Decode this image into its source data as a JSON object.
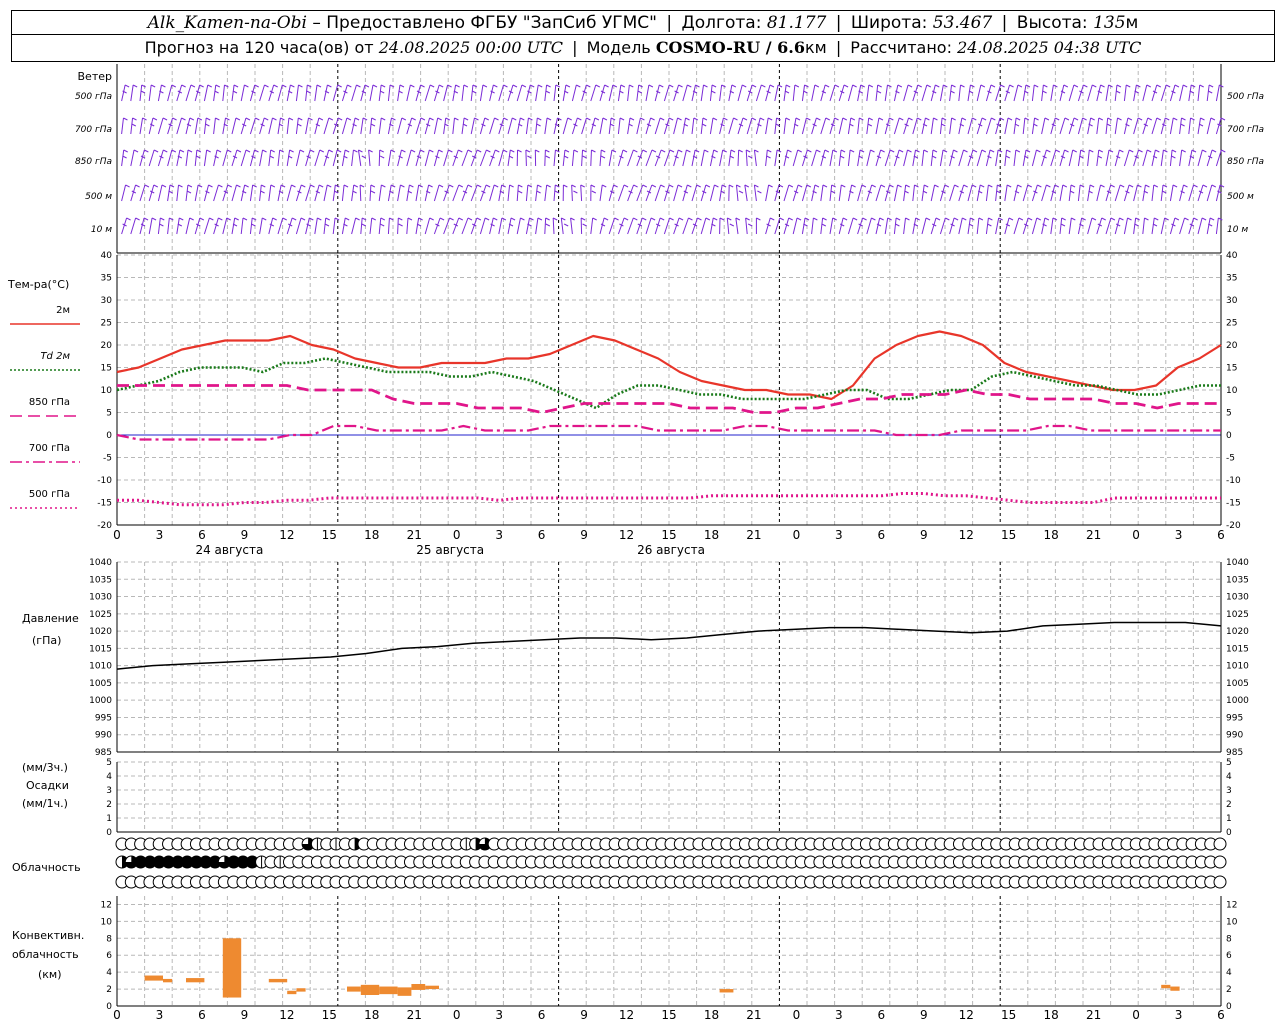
{
  "header": {
    "station": "Alk_Kamen-na-Obi",
    "provider": "– Предоставлено ФГБУ \"ЗапСиб УГМС\"",
    "lon_label": "Долгота:",
    "lon_value": "81.177",
    "lat_label": "Широта:",
    "lat_value": "53.467",
    "alt_label": "Высота:",
    "alt_value": "135",
    "alt_unit": "м",
    "forecast_label": "Прогноз на 120 часа(ов) от",
    "forecast_start": "24.08.2025 00:00 UTC",
    "model_label": "Модель",
    "model_name": "COSMO-RU / 6.6",
    "model_unit": "км",
    "calc_label": "Рассчитано:",
    "calc_time": "24.08.2025 04:38 UTC"
  },
  "colors": {
    "t2m": "#e8352a",
    "td2m": "#1a7a1a",
    "t850": "#e0158a",
    "t700": "#e0158a",
    "t500": "#e0158a",
    "wind": "#7a2bd6",
    "pressure": "#000000",
    "convective": "#ee8a30",
    "grid": "#b8b8b8"
  },
  "time_axis": {
    "hour_ticks": [
      "0",
      "3",
      "6",
      "9",
      "12",
      "15",
      "18",
      "21",
      "0",
      "3",
      "6",
      "9",
      "12",
      "15",
      "18",
      "21",
      "0",
      "3",
      "6",
      "9",
      "12",
      "15",
      "18",
      "21",
      "0",
      "3",
      "6"
    ],
    "day_labels": [
      "24 августа",
      "25 августа",
      "26 августа"
    ]
  },
  "chart_data": [
    {
      "panel": "wind",
      "type": "table",
      "title": "Ветер",
      "levels": [
        "500 гПа",
        "700 гПа",
        "850 гПа",
        "500 м",
        "10 м"
      ],
      "x_hours": [
        0,
        120
      ]
    },
    {
      "panel": "temperature",
      "type": "line",
      "title": "Тем-ра(°С)",
      "x_hours_step": 3,
      "ylim": [
        -20,
        40
      ],
      "y_ticks": [
        40,
        35,
        30,
        25,
        20,
        15,
        10,
        5,
        0,
        -5,
        -10,
        -15,
        -20
      ],
      "grid": true,
      "series": [
        {
          "name": "2м",
          "style": "solid",
          "values": [
            14,
            15,
            17,
            19,
            20,
            21,
            21,
            21,
            22,
            20,
            19,
            17,
            16,
            15,
            15,
            16,
            16,
            16,
            17,
            17,
            18,
            20,
            22,
            21,
            19,
            17,
            14,
            12,
            11,
            10,
            10,
            9,
            9,
            8,
            11,
            17,
            20,
            22,
            23,
            22,
            20,
            16,
            14,
            13,
            12,
            11,
            10,
            10,
            11,
            15,
            17,
            20
          ]
        },
        {
          "name": "Td 2м",
          "style": "dotted",
          "values": [
            10,
            11,
            12,
            14,
            15,
            15,
            15,
            14,
            16,
            16,
            17,
            16,
            15,
            14,
            14,
            14,
            13,
            13,
            14,
            13,
            12,
            10,
            8,
            6,
            9,
            11,
            11,
            10,
            9,
            9,
            8,
            8,
            8,
            8,
            9,
            10,
            10,
            8,
            8,
            9,
            10,
            10,
            13,
            14,
            13,
            12,
            11,
            11,
            10,
            9,
            9,
            10,
            11,
            11
          ]
        },
        {
          "name": "850 гПа",
          "style": "dashed",
          "values": [
            11,
            11,
            11,
            11,
            11,
            11,
            11,
            11,
            11,
            10,
            10,
            10,
            10,
            8,
            7,
            7,
            7,
            6,
            6,
            6,
            5,
            6,
            7,
            7,
            7,
            7,
            7,
            6,
            6,
            6,
            5,
            5,
            6,
            6,
            7,
            8,
            8,
            9,
            9,
            9,
            10,
            9,
            9,
            8,
            8,
            8,
            8,
            7,
            7,
            6,
            7,
            7,
            7
          ]
        },
        {
          "name": "700 гПа",
          "style": "dashdot",
          "values": [
            0,
            -1,
            -1,
            -1,
            -1,
            -1,
            -1,
            -1,
            0,
            0,
            2,
            2,
            1,
            1,
            1,
            1,
            2,
            1,
            1,
            1,
            2,
            2,
            2,
            2,
            2,
            1,
            1,
            1,
            1,
            2,
            2,
            1,
            1,
            1,
            1,
            1,
            0,
            0,
            0,
            1,
            1,
            1,
            1,
            2,
            2,
            1,
            1,
            1,
            1,
            1,
            1,
            1
          ]
        },
        {
          "name": "500 гПа",
          "style": "dotted-thick",
          "values": [
            -14.5,
            -14.5,
            -15,
            -15.5,
            -15.5,
            -15.5,
            -15,
            -15,
            -14.5,
            -14.5,
            -14,
            -14,
            -14,
            -14,
            -14,
            -14,
            -14,
            -14,
            -14.5,
            -14,
            -14,
            -14,
            -14,
            -14,
            -14,
            -14,
            -14,
            -14,
            -13.5,
            -13.5,
            -13.5,
            -13.5,
            -13.5,
            -13.5,
            -13.5,
            -13.5,
            -13.5,
            -13,
            -13,
            -13.5,
            -13.5,
            -14,
            -14.5,
            -15,
            -15,
            -15,
            -15,
            -14,
            -14,
            -14,
            -14,
            -14,
            -14
          ]
        }
      ]
    },
    {
      "panel": "pressure",
      "type": "line",
      "title": "Давление",
      "unit": "(гПа)",
      "ylim": [
        985,
        1040
      ],
      "y_ticks": [
        1040,
        1035,
        1030,
        1025,
        1020,
        1015,
        1010,
        1005,
        1000,
        995,
        990,
        985
      ],
      "series": [
        {
          "name": "",
          "values": [
            1009,
            1010,
            1010.5,
            1011,
            1011.5,
            1012,
            1012.5,
            1013.5,
            1015,
            1015.5,
            1016.5,
            1017,
            1017.5,
            1018,
            1018,
            1017.5,
            1018,
            1019,
            1020,
            1020.5,
            1021,
            1021,
            1020.5,
            1020,
            1019.5,
            1020,
            1021.5,
            1022,
            1022.5,
            1022.5,
            1022.5,
            1021.5
          ]
        }
      ]
    },
    {
      "panel": "precipitation",
      "type": "bar",
      "title": "Осадки",
      "unit_top": "(мм/3ч.)",
      "unit_bottom": "(мм/1ч.)",
      "ylim": [
        0,
        5
      ],
      "y_ticks": [
        5,
        4,
        3,
        2,
        1,
        0
      ],
      "values": []
    },
    {
      "panel": "cloudiness",
      "type": "table",
      "title": "Облачность",
      "rows": [
        "00000000000000000000310102000000000001230000000000000000000000000000000000000000000000000000000000000000000000000000000",
        "23444444444344410100000000000000000000000000000000000000000000000000000000000000000000000000000000000000000000000000000",
        "00000000000000000000000000000000000000000000000000000000000000000000000000000000000000000000000000000000000000000000000"
      ]
    },
    {
      "panel": "convective",
      "type": "bar",
      "title": "Конвективн. облачность",
      "unit": "(км)",
      "ylim": [
        0,
        13
      ],
      "y_ticks": [
        12,
        10,
        8,
        6,
        4,
        2,
        0
      ],
      "segments": [
        {
          "t0": 3,
          "t1": 5,
          "base": 3,
          "top": 3.6
        },
        {
          "t0": 5,
          "t1": 6,
          "base": 2.8,
          "top": 3.2
        },
        {
          "t0": 7.5,
          "t1": 9.5,
          "base": 2.8,
          "top": 3.3
        },
        {
          "t0": 11.5,
          "t1": 12.5,
          "base": 1,
          "top": 8
        },
        {
          "t0": 12.5,
          "t1": 13.5,
          "base": 1,
          "top": 8
        },
        {
          "t0": 16.5,
          "t1": 18.5,
          "base": 2.8,
          "top": 3.2
        },
        {
          "t0": 18.5,
          "t1": 19.5,
          "base": 1.4,
          "top": 1.8
        },
        {
          "t0": 19.5,
          "t1": 20.5,
          "base": 1.7,
          "top": 2.1
        },
        {
          "t0": 25,
          "t1": 26.5,
          "base": 1.7,
          "top": 2.3
        },
        {
          "t0": 26.5,
          "t1": 28.5,
          "base": 1.3,
          "top": 2.5
        },
        {
          "t0": 28.5,
          "t1": 30.5,
          "base": 1.4,
          "top": 2.3
        },
        {
          "t0": 30.5,
          "t1": 32,
          "base": 1.2,
          "top": 2.2
        },
        {
          "t0": 32,
          "t1": 33.5,
          "base": 1.9,
          "top": 2.6
        },
        {
          "t0": 33.5,
          "t1": 35,
          "base": 2.0,
          "top": 2.4
        },
        {
          "t0": 65.5,
          "t1": 67,
          "base": 1.6,
          "top": 2.0
        },
        {
          "t0": 113.5,
          "t1": 114.5,
          "base": 2.1,
          "top": 2.5
        },
        {
          "t0": 114.5,
          "t1": 115.5,
          "base": 1.8,
          "top": 2.3
        }
      ]
    }
  ],
  "cloud_rows_times": [
    0,
    120
  ]
}
